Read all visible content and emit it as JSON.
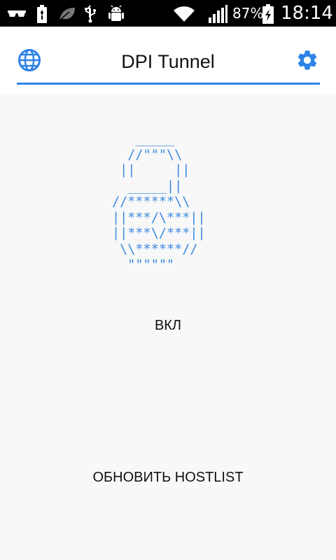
{
  "status_bar": {
    "icons": [
      "glasses-icon",
      "battery-saver-icon",
      "leaf-icon",
      "usb-icon",
      "android-debug-icon",
      "wifi-icon",
      "signal-icon",
      "battery-charging-icon"
    ],
    "battery_percent": "87%",
    "time": "18:14"
  },
  "toolbar": {
    "title": "DPI Tunnel",
    "left_icon": "globe-icon",
    "right_icon": "gear-icon",
    "accent_color": "#2e82e6"
  },
  "main": {
    "lock_art": "   _____\n  //\"\"\"\\\\\n ||     ||\n  _____||\n//******\\\\\n||***/\\***||\n||***\\/***||\n \\\\******//\n  \"\"\"\"\"\"",
    "lock_color": "#3b8be3",
    "status_label": "ВКЛ",
    "update_button_label": "ОБНОВИТЬ HOSTLIST"
  }
}
